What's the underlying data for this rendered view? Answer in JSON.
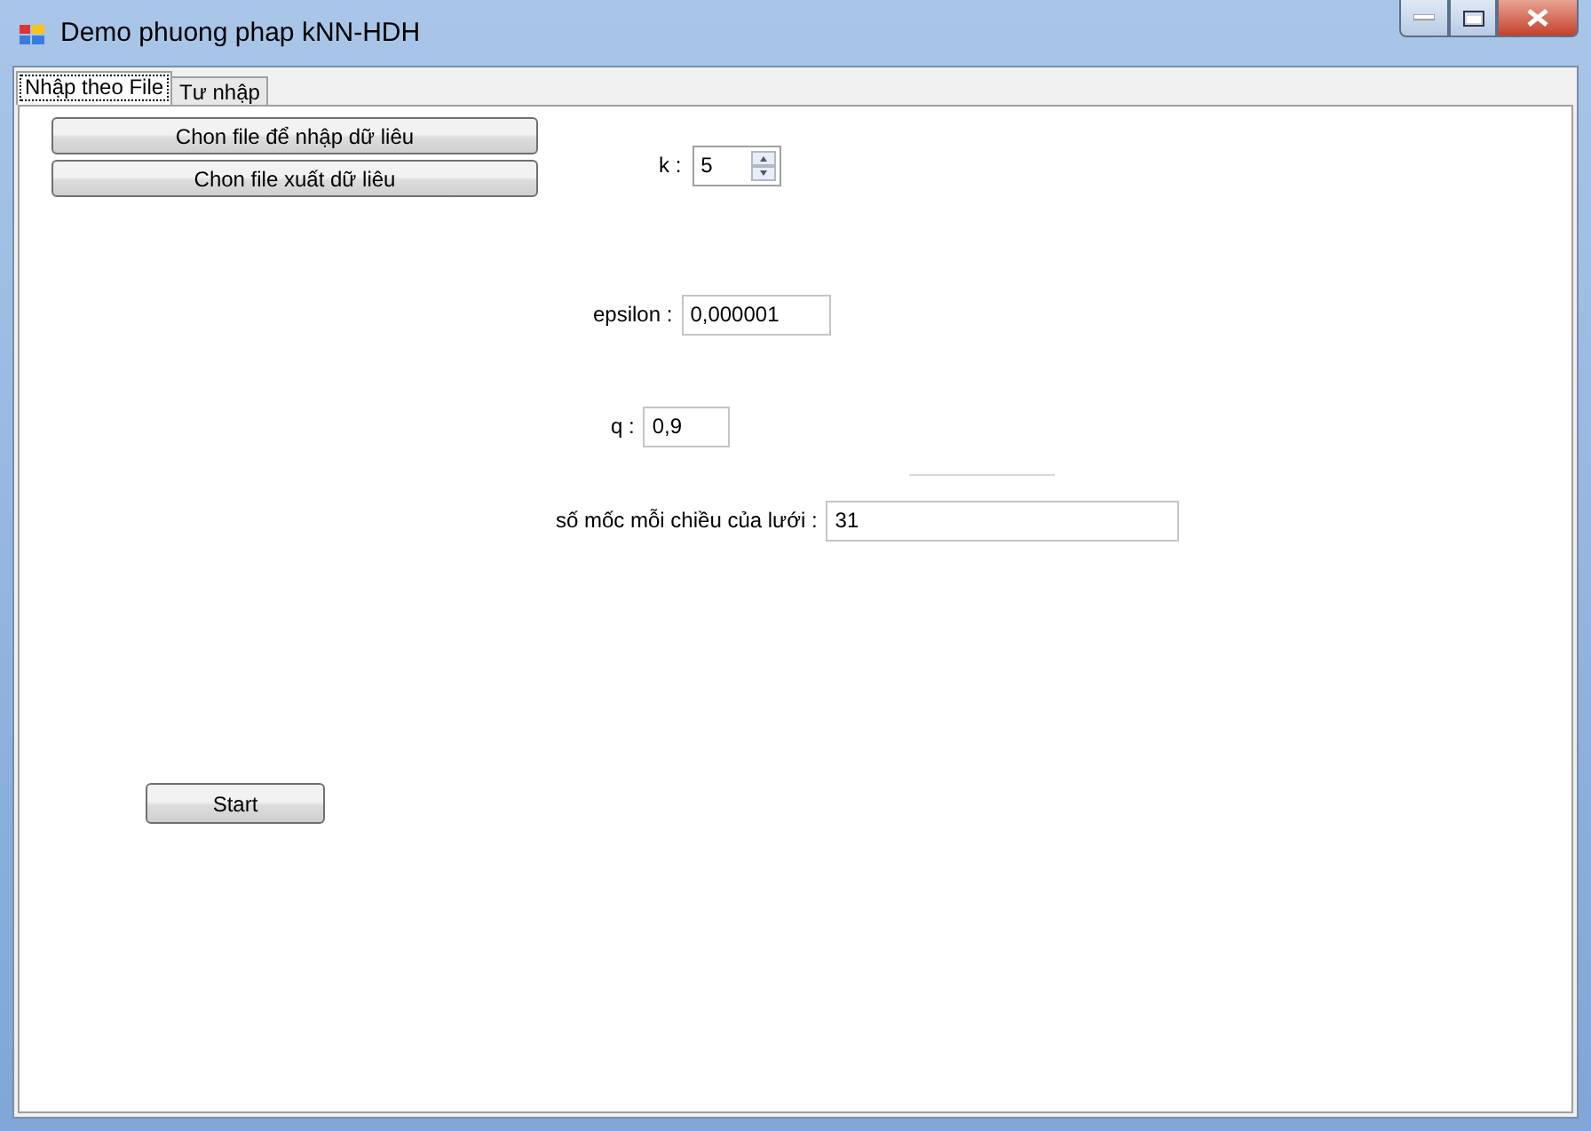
{
  "window": {
    "title": "Demo phuong phap kNN-HDH"
  },
  "tabs": [
    {
      "label": "Nhập theo File",
      "selected": true
    },
    {
      "label": "Tư nhập",
      "selected": false
    }
  ],
  "file_buttons": [
    "Chon file để nhập dữ liêu",
    "Chon file xuất dữ liêu"
  ],
  "k": {
    "label": "k :",
    "value": "5"
  },
  "epsilon": {
    "label": "epsilon :",
    "value": "0,000001"
  },
  "q": {
    "label": "q :",
    "value": "0,9"
  },
  "grid": {
    "label": "số mốc mỗi chiều của lưới :",
    "value": "31"
  },
  "start_button": "Start"
}
